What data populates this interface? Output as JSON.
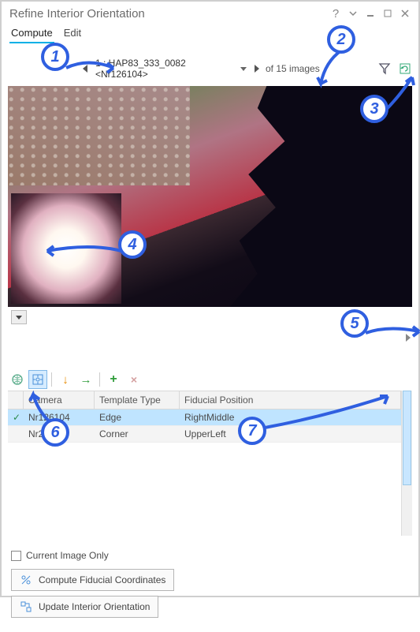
{
  "window": {
    "title": "Refine Interior Orientation"
  },
  "menu": {
    "compute": "Compute",
    "edit": "Edit"
  },
  "nav": {
    "selected": "1 : HAP83_333_0082 <Nr126104>",
    "count_text": "of 15 images"
  },
  "toolbar": {
    "globe": "globe-icon",
    "target": "fiducial-target-icon",
    "down": "↓",
    "right": "→",
    "plus": "+",
    "delete": "×"
  },
  "table": {
    "headers": {
      "camera": "Camera",
      "template": "Template Type",
      "fiducial": "Fiducial Position"
    },
    "rows": [
      {
        "checked": true,
        "camera": "Nr126104",
        "template": "Edge",
        "fiducial": "RightMiddle",
        "selected": true
      },
      {
        "checked": false,
        "camera": "Nr20205",
        "template": "Corner",
        "fiducial": "UpperLeft",
        "selected": false
      }
    ]
  },
  "options": {
    "current_image_only": "Current Image Only"
  },
  "buttons": {
    "compute_fiducial": "Compute Fiducial Coordinates",
    "update_orientation": "Update Interior Orientation"
  },
  "callouts": {
    "c1": "1",
    "c2": "2",
    "c3": "3",
    "c4": "4",
    "c5": "5",
    "c6": "6",
    "c7": "7"
  }
}
